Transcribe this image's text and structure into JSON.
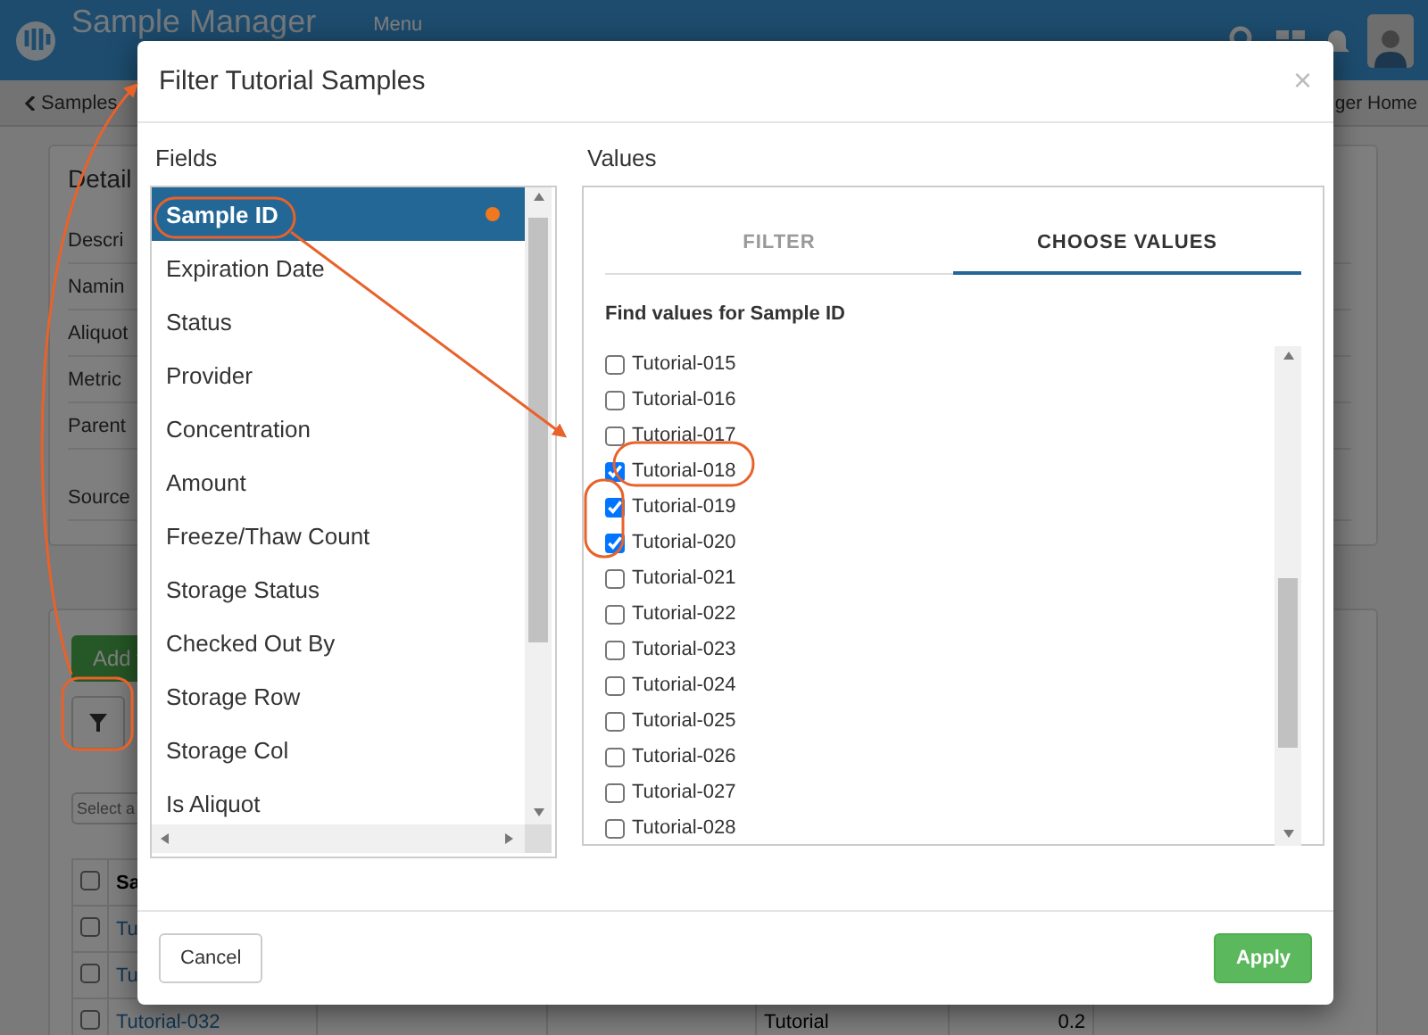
{
  "app": {
    "title": "Sample Manager",
    "menu_label": "Menu"
  },
  "breadcrumb": {
    "back": "Samples",
    "right": "ger Home"
  },
  "detail_panel": {
    "title": "Detail",
    "labels": [
      "Descri",
      "Namin",
      "Aliquot",
      "Metric",
      "Parent",
      "Source"
    ]
  },
  "grid_panel": {
    "add_button": "Add",
    "select_placeholder": "Select a",
    "header": {
      "checked": false,
      "column_1": "Sa"
    },
    "rows": [
      {
        "checked": false,
        "sample": "Tu"
      },
      {
        "checked": false,
        "sample": "Tu"
      },
      {
        "checked": false,
        "sample": "Tutorial-032",
        "column_5": "Tutorial",
        "column_6": "0.2"
      }
    ]
  },
  "dialog": {
    "title": "Filter Tutorial Samples",
    "close": "×",
    "fields_label": "Fields",
    "values_label": "Values",
    "fields": [
      {
        "label": "Sample ID",
        "selected": true,
        "filtered": true
      },
      {
        "label": "Expiration Date",
        "selected": false,
        "filtered": false
      },
      {
        "label": "Status",
        "selected": false,
        "filtered": false
      },
      {
        "label": "Provider",
        "selected": false,
        "filtered": false
      },
      {
        "label": "Concentration",
        "selected": false,
        "filtered": false
      },
      {
        "label": "Amount",
        "selected": false,
        "filtered": false
      },
      {
        "label": "Freeze/Thaw Count",
        "selected": false,
        "filtered": false
      },
      {
        "label": "Storage Status",
        "selected": false,
        "filtered": false
      },
      {
        "label": "Checked Out By",
        "selected": false,
        "filtered": false
      },
      {
        "label": "Storage Row",
        "selected": false,
        "filtered": false
      },
      {
        "label": "Storage Col",
        "selected": false,
        "filtered": false
      },
      {
        "label": "Is Aliquot",
        "selected": false,
        "filtered": false
      }
    ],
    "tabs": [
      {
        "label": "FILTER",
        "selected": false
      },
      {
        "label": "CHOOSE VALUES",
        "selected": true
      }
    ],
    "values_heading": "Find values for Sample ID",
    "values": [
      {
        "label": "Tutorial-015",
        "checked": false
      },
      {
        "label": "Tutorial-016",
        "checked": false
      },
      {
        "label": "Tutorial-017",
        "checked": false
      },
      {
        "label": "Tutorial-018",
        "checked": true
      },
      {
        "label": "Tutorial-019",
        "checked": true
      },
      {
        "label": "Tutorial-020",
        "checked": true
      },
      {
        "label": "Tutorial-021",
        "checked": false
      },
      {
        "label": "Tutorial-022",
        "checked": false
      },
      {
        "label": "Tutorial-023",
        "checked": false
      },
      {
        "label": "Tutorial-024",
        "checked": false
      },
      {
        "label": "Tutorial-025",
        "checked": false
      },
      {
        "label": "Tutorial-026",
        "checked": false
      },
      {
        "label": "Tutorial-027",
        "checked": false
      },
      {
        "label": "Tutorial-028",
        "checked": false
      }
    ],
    "buttons": {
      "cancel": "Cancel",
      "apply": "Apply"
    }
  }
}
